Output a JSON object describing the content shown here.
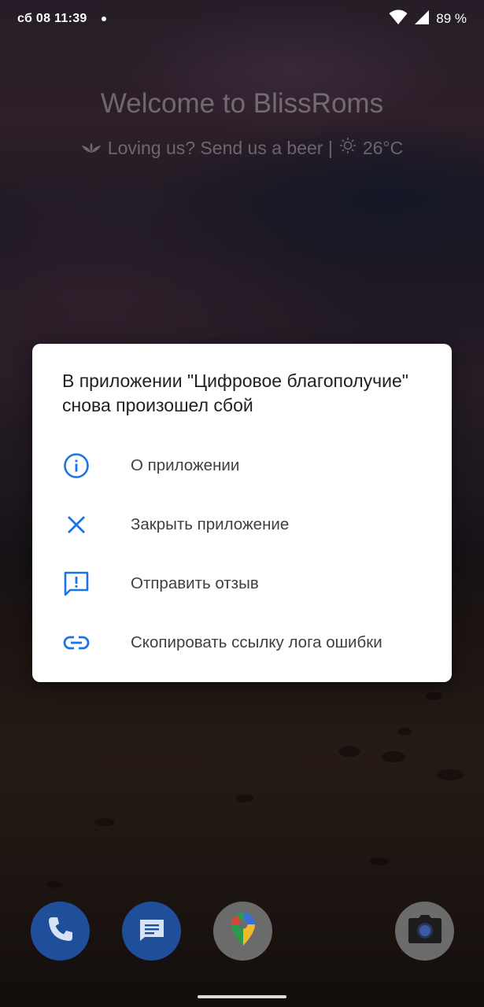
{
  "status_bar": {
    "time": "сб 08 11:39",
    "battery": "89 %"
  },
  "home": {
    "welcome": "Welcome to BlissRoms",
    "tagline": "Loving us? Send us a beer |",
    "temperature": "26°C"
  },
  "dialog": {
    "title": "В приложении \"Цифровое благополучие\" снова произошел сбой",
    "options": [
      {
        "label": "О приложении",
        "icon": "info-icon"
      },
      {
        "label": "Закрыть приложение",
        "icon": "close-icon"
      },
      {
        "label": "Отправить отзыв",
        "icon": "feedback-icon"
      },
      {
        "label": "Скопировать ссылку лога ошибки",
        "icon": "link-icon"
      }
    ],
    "accent_color": "#1a73e8"
  },
  "dock": {
    "apps": [
      "phone-icon",
      "messages-icon",
      "maps-icon",
      "camera-icon"
    ]
  }
}
